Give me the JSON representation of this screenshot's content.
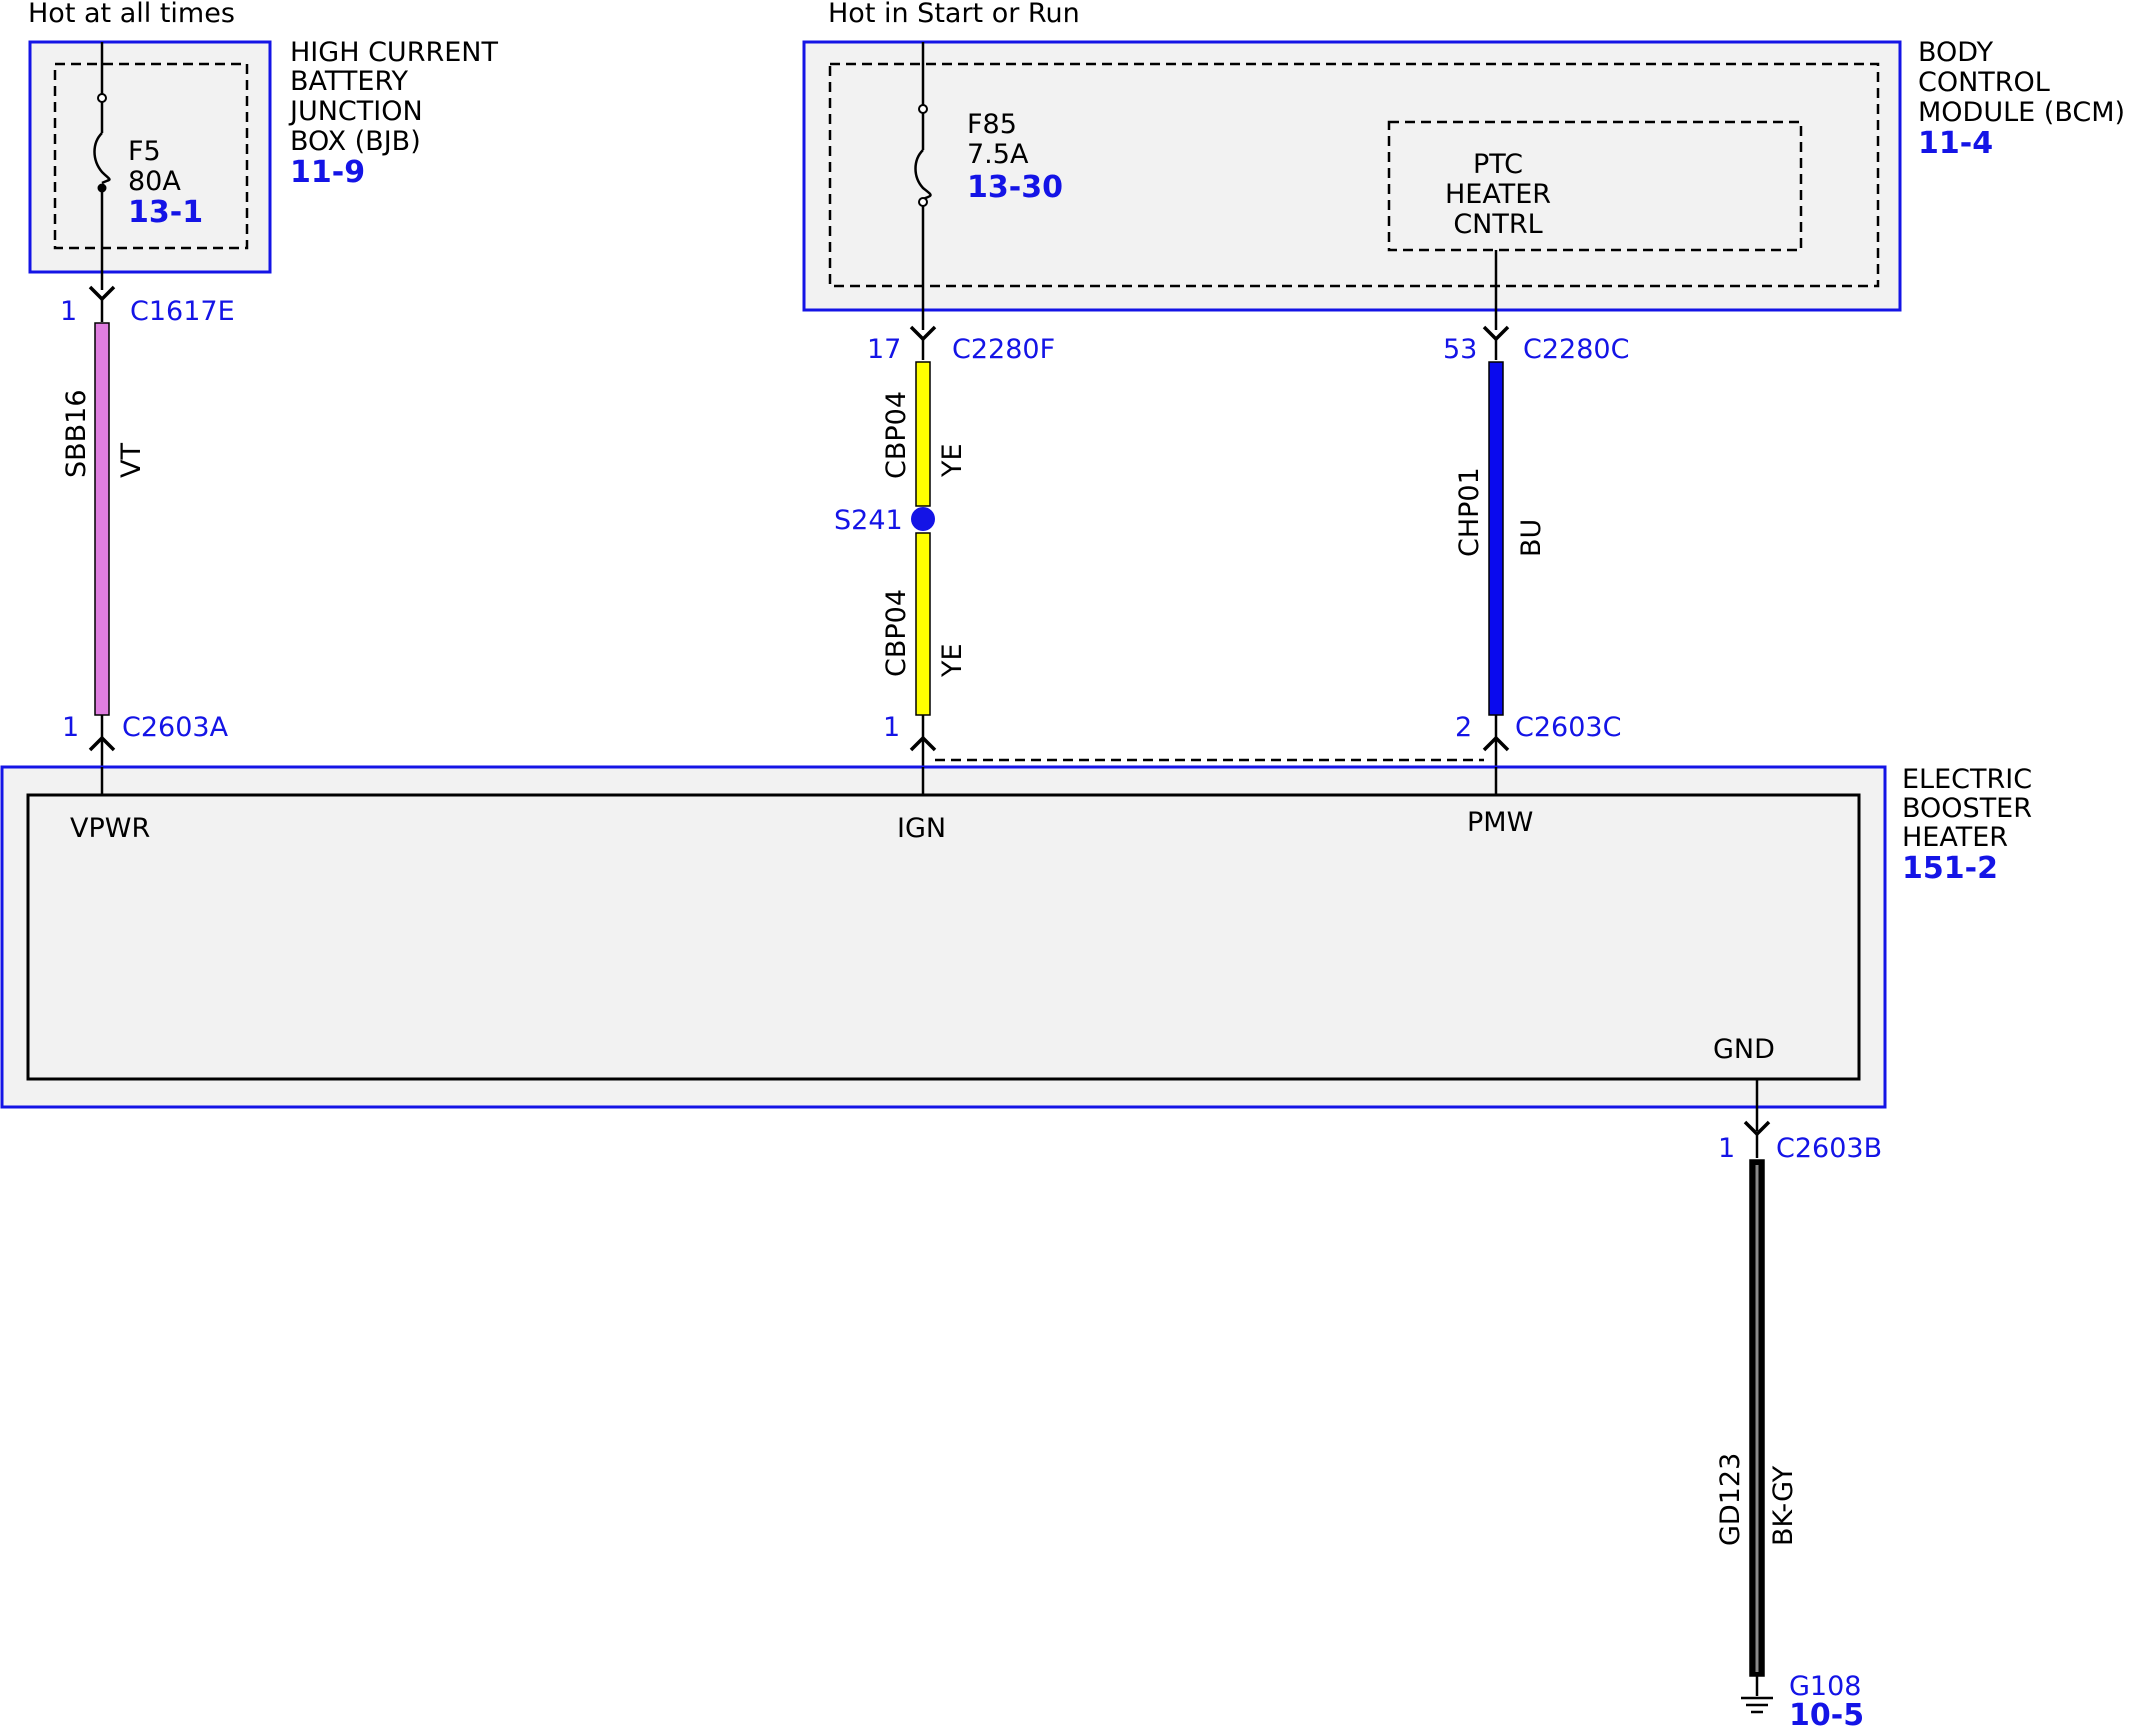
{
  "supply": {
    "hot_at_all_times": "Hot at all times",
    "hot_in_start_or_run": "Hot in Start or Run"
  },
  "bjb": {
    "name_lines": [
      "HIGH CURRENT",
      "BATTERY",
      "JUNCTION",
      "BOX (BJB)"
    ],
    "ref": "11-9",
    "fuse_name": "F5",
    "fuse_rating": "80A",
    "fuse_ref": "13-1"
  },
  "bcm": {
    "name_lines": [
      "BODY",
      "CONTROL",
      "MODULE (BCM)"
    ],
    "ref": "11-4",
    "fuse_name": "F85",
    "fuse_rating": "7.5A",
    "fuse_ref": "13-30",
    "inner_box_lines": [
      "PTC",
      "HEATER",
      "CNTRL"
    ]
  },
  "heater": {
    "name_lines": [
      "ELECTRIC",
      "BOOSTER",
      "HEATER"
    ],
    "ref": "151-2",
    "pins": [
      "VPWR",
      "IGN",
      "PMW",
      "GND"
    ]
  },
  "connectors": {
    "c1617e": {
      "pin": "1",
      "name": "C1617E"
    },
    "c2280f": {
      "pin": "17",
      "name": "C2280F"
    },
    "c2280c": {
      "pin": "53",
      "name": "C2280C"
    },
    "c2603a": {
      "pin": "1",
      "name": "C2603A"
    },
    "c2603_ign": {
      "pin": "1"
    },
    "c2603c": {
      "pin": "2",
      "name": "C2603C"
    },
    "c2603b": {
      "pin": "1",
      "name": "C2603B"
    }
  },
  "wires": {
    "sbb16": {
      "circuit": "SBB16",
      "color": "VT",
      "hex": "#e07ee0"
    },
    "cbp04_upper": {
      "circuit": "CBP04",
      "color": "YE",
      "hex": "#ffff00"
    },
    "cbp04_lower": {
      "circuit": "CBP04",
      "color": "YE",
      "hex": "#ffff00"
    },
    "chp01": {
      "circuit": "CHP01",
      "color": "BU",
      "hex": "#0a0aee"
    },
    "gd123": {
      "circuit": "GD123",
      "color": "BK-GY",
      "hex": "#000000"
    }
  },
  "splice": {
    "name": "S241"
  },
  "ground": {
    "name": "G108",
    "ref": "10-5"
  },
  "colors": {
    "outline_blue": "#1414e6",
    "module_fill": "#f2f2f2"
  }
}
